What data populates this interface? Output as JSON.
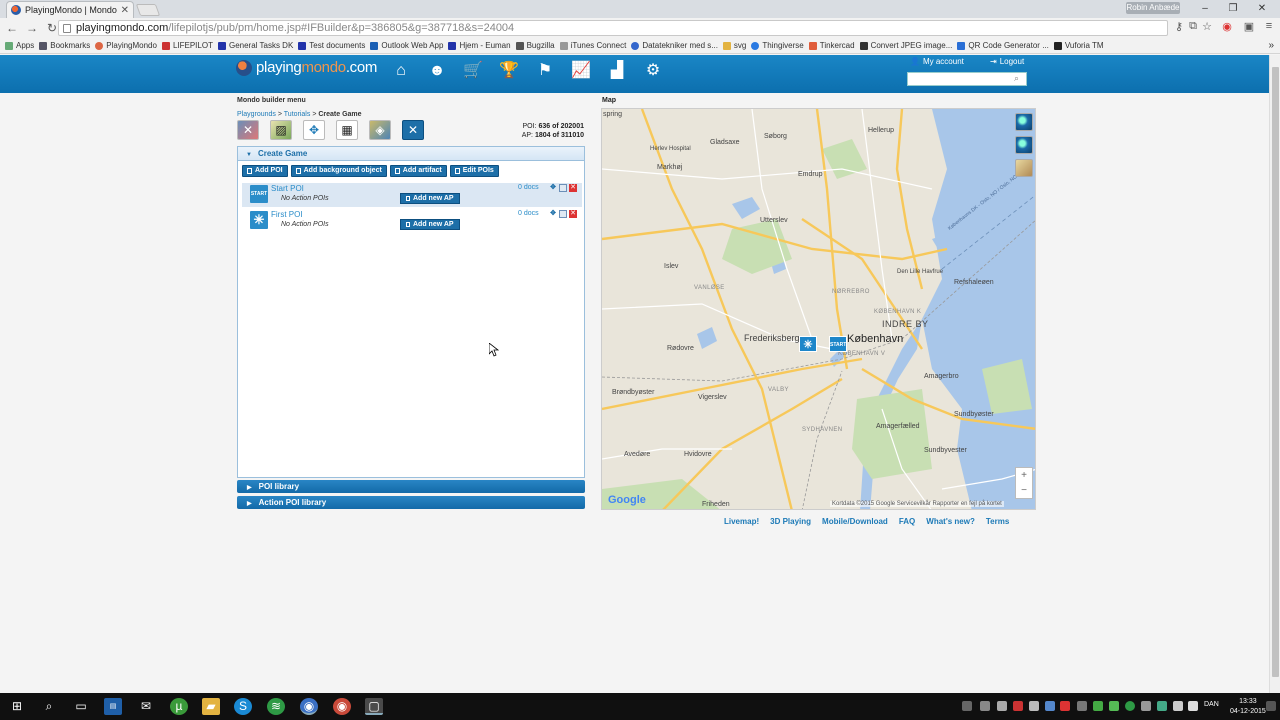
{
  "browser": {
    "tab_title": "PlayingMondo | Mondo b",
    "user_chip": "Robin Anbæde",
    "url_host": "playingmondo.com",
    "url_path": "/lifepilotjs/pub/pm/home.jsp#IFBuilder&p=386805&g=387718&s=24004",
    "bookmarks": [
      "Apps",
      "Bookmarks",
      "PlayingMondo",
      "LIFEPILOT",
      "General Tasks DK",
      "Test documents",
      "Outlook Web App",
      "Hjem - Euman",
      "Bugzilla",
      "iTunes Connect",
      "Datatekniker med s...",
      "svg",
      "Thingiverse",
      "Tinkercad",
      "Convert JPEG image...",
      "QR Code Generator ...",
      "Vuforia TM"
    ]
  },
  "site": {
    "logo_a": "playing",
    "logo_b": "mondo",
    "logo_c": ".com",
    "my_account": "My account",
    "logout": "Logout",
    "search_placeholder": ""
  },
  "builder": {
    "menu_title": "Mondo builder menu",
    "breadcrumb": {
      "playgrounds": "Playgrounds",
      "tutorials": "Tutorials",
      "current": "Create Game",
      "sep": " > "
    },
    "stats": {
      "poi_label": "POI:",
      "poi_value": "636 of 202001",
      "ap_label": "AP:",
      "ap_value": "1804 of 311010"
    },
    "panel_title": "Create Game",
    "buttons": {
      "add_poi": "Add POI",
      "add_background": "Add background object",
      "add_artifact": "Add artifact",
      "edit_pois": "Edit POIs"
    },
    "pois": [
      {
        "badge": "START",
        "name": "Start POI",
        "sub": "No Action POIs",
        "docs": "0 docs",
        "add": "Add new AP"
      },
      {
        "badge": "✳",
        "name": "First POI",
        "sub": "No Action POIs",
        "docs": "0 docs",
        "add": "Add new AP"
      }
    ],
    "poi_library": "POI library",
    "action_poi_library": "Action POI library"
  },
  "map": {
    "title": "Map",
    "labels": {
      "spring": "spring",
      "soborg": "Søborg",
      "hellerup": "Hellerup",
      "herlev": "Herlev Hospital",
      "gladsaxe": "Gladsaxe",
      "markhaj": "Markhøj",
      "emdrup": "Emdrup",
      "utterslev": "Utterslev",
      "islev": "Islev",
      "norrebro": "NØRREBRO",
      "den_lille_havfrue": "Den Lille Havfrue",
      "refshaleoen": "Refshaleøen",
      "vanlose": "VANLØSE",
      "kobenhavn_k": "KØBENHAVN K",
      "indre_by": "INDRE BY",
      "frederiksberg": "Frederiksberg",
      "kobenhavn": "København",
      "kobenhavn_v": "KØBENHAVN V",
      "rodovre": "Rødovre",
      "brondbyoster": "Brøndbyøster",
      "valby": "VALBY",
      "vigerslev": "Vigerslev",
      "amagerbro": "Amagerbro",
      "sundbyoster": "Sundbyøster",
      "amagerfaelled": "Amagerfælled",
      "sydhavnen": "SYDHAVNEN",
      "avedore": "Avedøre",
      "hvidovre": "Hvidovre",
      "sundbyvester": "Sundbyvester",
      "friheden": "Friheden",
      "ferry": "Københavns DK - Oslo, NO / Oslo, NO - ..."
    },
    "google": "Google",
    "attribution": "Kortdata ©2015 Google   Servicevilkår   Rapporter en fejl på kortet",
    "markers": {
      "start": "START",
      "first": "✳"
    }
  },
  "footer": {
    "links": [
      "Livemap!",
      "3D Playing",
      "Mobile/Download",
      "FAQ",
      "What's new?",
      "Terms"
    ]
  },
  "taskbar": {
    "lang": "DAN",
    "time": "13:33",
    "date": "04-12-2015"
  }
}
